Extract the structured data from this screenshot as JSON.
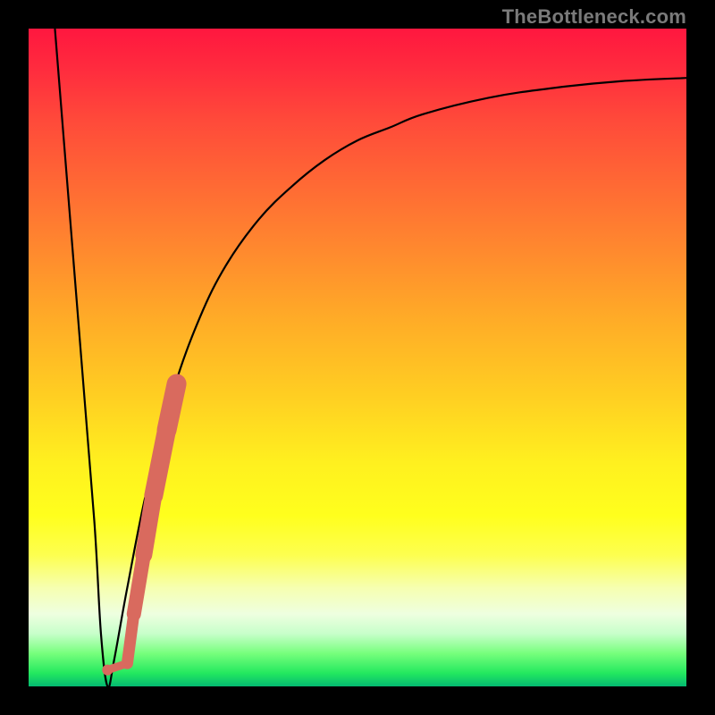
{
  "watermark": "TheBottleneck.com",
  "chart_data": {
    "type": "line",
    "title": "",
    "xlabel": "",
    "ylabel": "",
    "xlim": [
      0,
      100
    ],
    "ylim": [
      0,
      100
    ],
    "grid": false,
    "background": "red-yellow-green vertical gradient",
    "series": [
      {
        "name": "bottleneck-curve",
        "x": [
          4,
          6,
          8,
          10,
          11,
          12,
          13,
          15,
          18,
          22,
          26,
          30,
          35,
          40,
          45,
          50,
          55,
          60,
          70,
          80,
          90,
          100
        ],
        "values": [
          100,
          75,
          50,
          25,
          8,
          0,
          4,
          15,
          30,
          45,
          56,
          64,
          71,
          76,
          80,
          83,
          85,
          87,
          89.5,
          91,
          92,
          92.5
        ]
      },
      {
        "name": "highlight-segment",
        "x": [
          12.0,
          15.0,
          16.0,
          17.5,
          19.0,
          21.0,
          22.5
        ],
        "values": [
          2.5,
          3.5,
          11,
          20,
          29,
          39,
          46
        ]
      }
    ],
    "colors": {
      "curve": "#000000",
      "highlight": "#d96a5e"
    }
  }
}
